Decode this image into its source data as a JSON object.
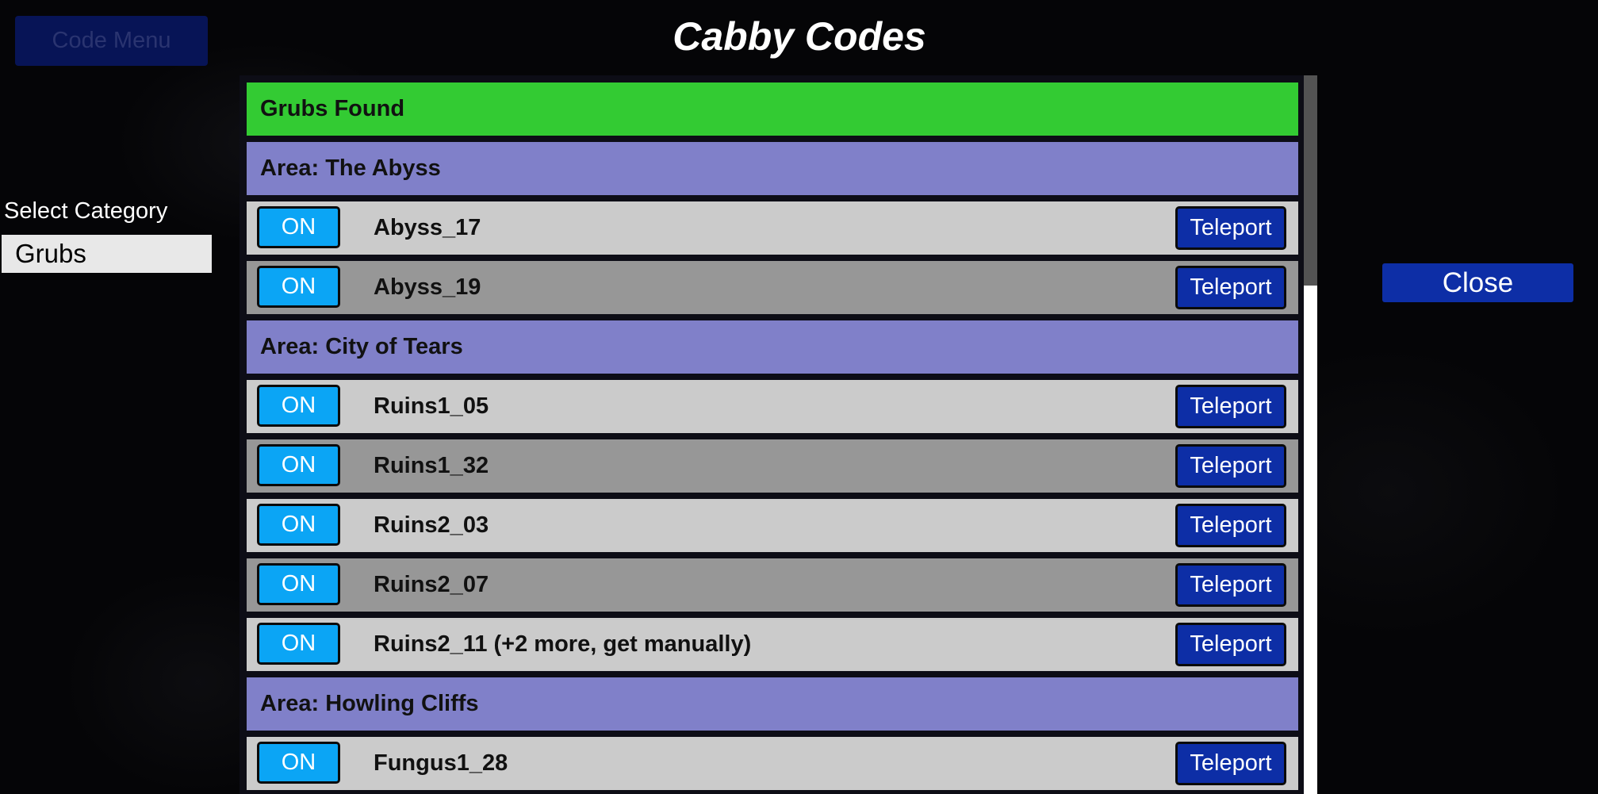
{
  "app": {
    "title": "Cabby Codes"
  },
  "code_menu": {
    "label": "Code Menu"
  },
  "category": {
    "label": "Select Category",
    "selected": "Grubs"
  },
  "close": {
    "label": "Close"
  },
  "list": {
    "header": "Grubs Found",
    "on_label": "ON",
    "teleport_label": "Teleport",
    "areas": [
      {
        "label": "Area: The Abyss",
        "items": [
          "Abyss_17",
          "Abyss_19"
        ]
      },
      {
        "label": "Area: City of Tears",
        "items": [
          "Ruins1_05",
          "Ruins1_32",
          "Ruins2_03",
          "Ruins2_07",
          "Ruins2_11 (+2 more, get manually)"
        ]
      },
      {
        "label": "Area: Howling Cliffs",
        "items": [
          "Fungus1_28"
        ]
      }
    ]
  },
  "colors": {
    "header": "#33cb33",
    "area": "#8080c9",
    "row_light": "#cbcbcb",
    "row_dark": "#979797",
    "on_button": "#0ba5f5",
    "teleport_button": "#0d2ea6"
  }
}
